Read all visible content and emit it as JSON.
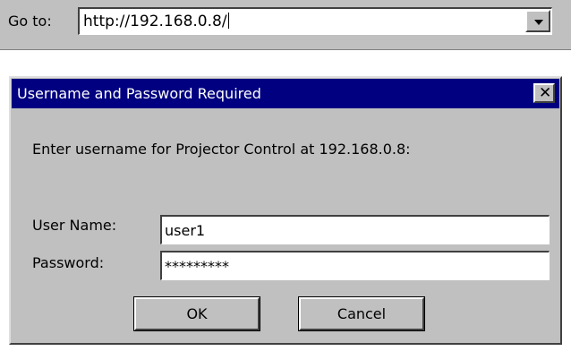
{
  "address_bar": {
    "label": "Go to:",
    "url": "http://192.168.0.8/",
    "dropdown_icon": "chevron-down-icon"
  },
  "dialog": {
    "title": "Username and Password Required",
    "close_glyph": "✕",
    "prompt": "Enter username for Projector Control at 192.168.0.8:",
    "username_label": "User Name:",
    "username_value": "user1",
    "password_label": "Password:",
    "password_value": "*********",
    "ok_label": "OK",
    "cancel_label": "Cancel"
  },
  "colors": {
    "titlebar": "#000080",
    "chrome": "#c0c0c0"
  }
}
